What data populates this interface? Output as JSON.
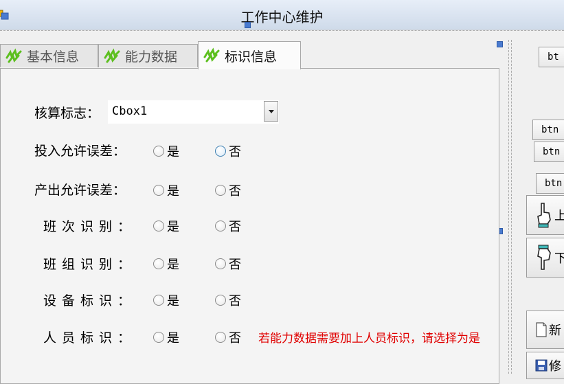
{
  "window": {
    "title": "工作中心维护"
  },
  "tabs": [
    {
      "label": "基本信息",
      "active": false
    },
    {
      "label": "能力数据",
      "active": false
    },
    {
      "label": "标识信息",
      "active": true
    }
  ],
  "form": {
    "accounting_flag": {
      "label": "核算标志：",
      "value": "Cbox1"
    },
    "rows": [
      {
        "label": "投入允许误差：",
        "yes": "是",
        "no": "否"
      },
      {
        "label": "产出允许误差：",
        "yes": "是",
        "no": "否"
      },
      {
        "label": "班次识别：",
        "yes": "是",
        "no": "否"
      },
      {
        "label": "班组识别：",
        "yes": "是",
        "no": "否"
      },
      {
        "label": "设备标识：",
        "yes": "是",
        "no": "否"
      },
      {
        "label": "人员标识：",
        "yes": "是",
        "no": "否"
      }
    ],
    "note": "若能力数据需要加上人员标识，请选择为是"
  },
  "right_panel": {
    "btn1": "bt",
    "btn2": "btn",
    "btn3": "btn",
    "btn4": "btn",
    "up_label": "上",
    "down_label": "下",
    "new_label": "新",
    "edit_label": "修"
  },
  "colors": {
    "note": "#e00000",
    "handle": "#4a7bd0",
    "tab_icon": "#5cbf1e"
  }
}
